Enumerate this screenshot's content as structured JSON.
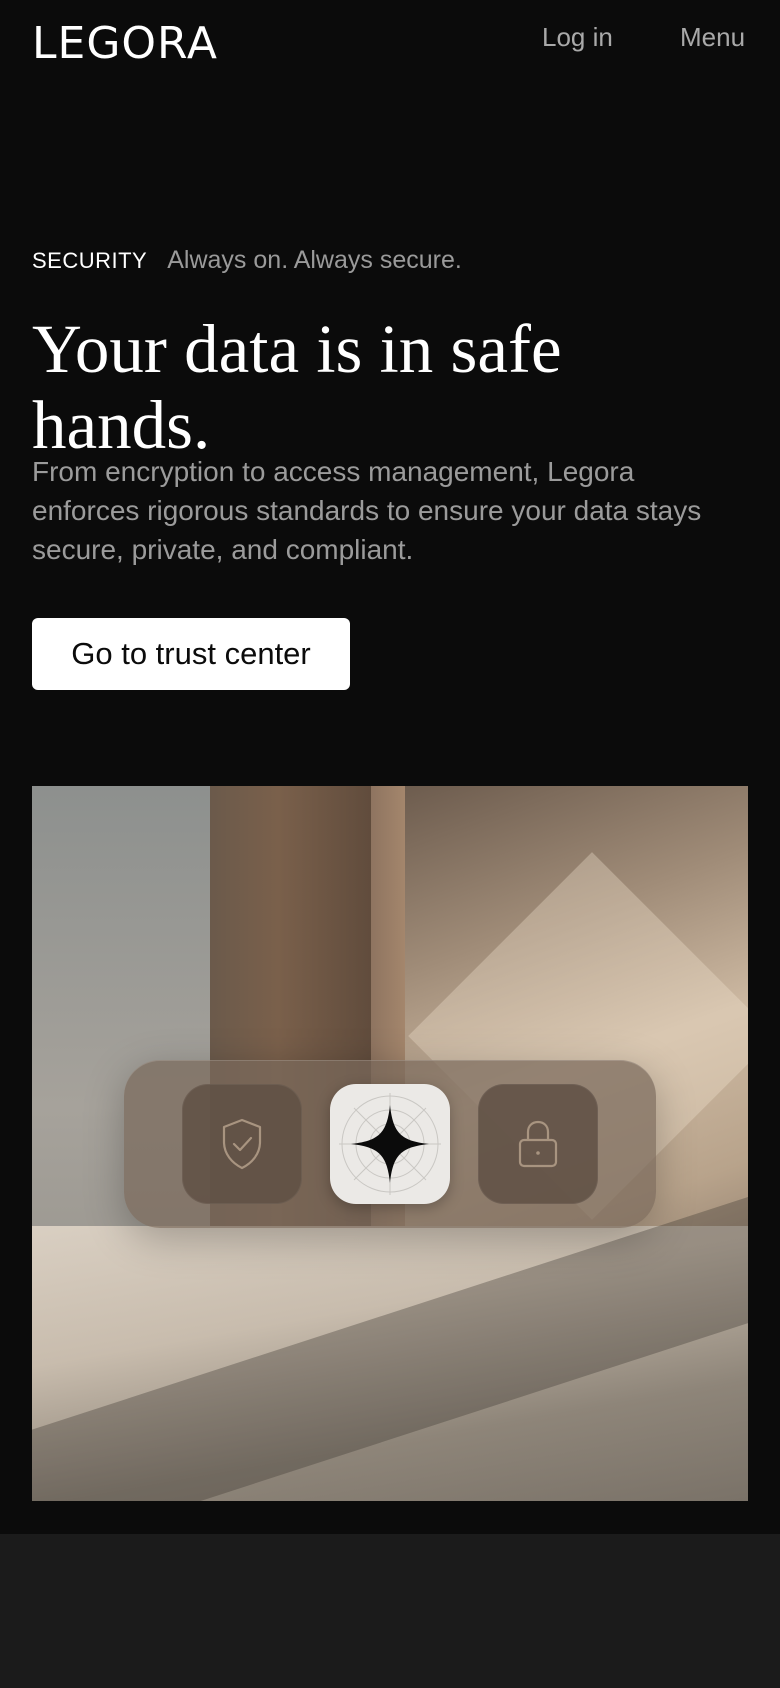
{
  "header": {
    "logo": "LEGORA",
    "login_label": "Log in",
    "menu_label": "Menu"
  },
  "hero": {
    "eyebrow_tag": "SECURITY",
    "eyebrow_text": "Always on. Always secure.",
    "headline": "Your data is in safe hands.",
    "body": "From encryption to access management, Legora enforces rigorous standards to ensure your data stays secure, private, and compliant.",
    "cta_label": "Go to trust center"
  },
  "illustration": {
    "icons": [
      "shield-check-icon",
      "legora-star-icon",
      "lock-icon"
    ]
  },
  "colors": {
    "background": "#0b0b0b",
    "text_primary": "#ffffff",
    "text_muted": "#9b9b9b",
    "cta_background": "#ffffff",
    "footer_band": "#1b1b1b"
  }
}
